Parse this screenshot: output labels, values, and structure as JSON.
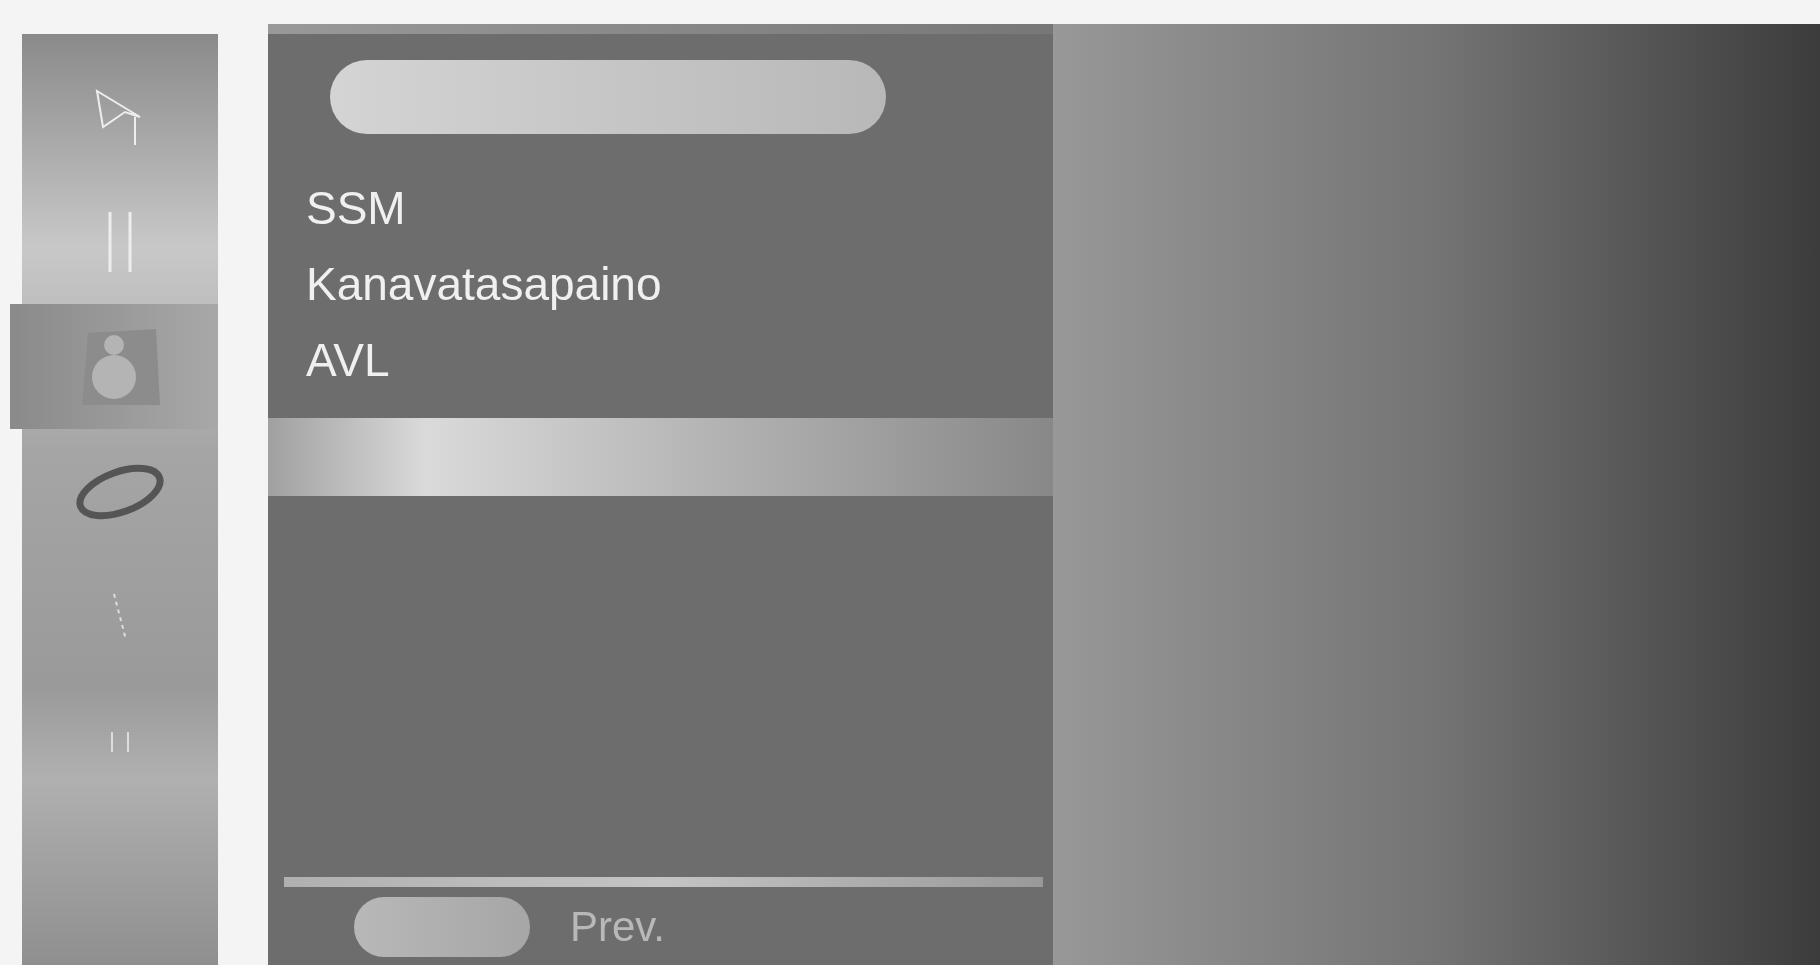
{
  "sidebar": {
    "items": [
      {
        "kind": "picture",
        "selected": false
      },
      {
        "kind": "bars",
        "selected": false
      },
      {
        "kind": "speaker",
        "selected": true
      },
      {
        "kind": "ring",
        "selected": false
      },
      {
        "kind": "slash",
        "selected": false
      },
      {
        "kind": "dots",
        "selected": false
      }
    ]
  },
  "menu": {
    "items": [
      {
        "label": "SSM"
      },
      {
        "label": "Kanavatasapaino"
      },
      {
        "label": "AVL"
      }
    ]
  },
  "footer": {
    "hint": "Prev."
  }
}
